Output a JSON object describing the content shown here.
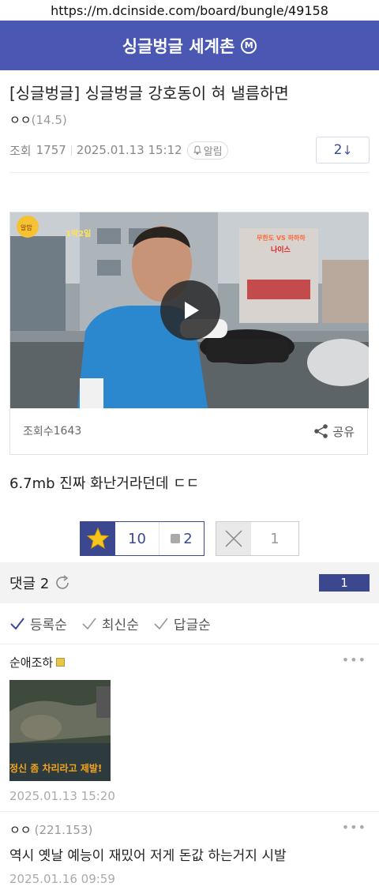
{
  "browser": {
    "url": "https://m.dcinside.com/board/bungle/49158"
  },
  "gallery": {
    "title": "싱글벙글 세계촌",
    "badge": "M"
  },
  "post": {
    "title": "[싱글벙글] 싱글벙글 강호동이 혀 낼름하면",
    "writer": "ㅇㅇ",
    "writer_ip": "(14.5)",
    "views_label": "조회",
    "views": "1757",
    "date": "2025.01.13 15:12",
    "alarm_label": "알림",
    "comment_count": "2",
    "body_text": "6.7mb 진짜 화난거라던데 ㄷㄷ"
  },
  "video": {
    "views_label": "조회수",
    "views": "1643",
    "share_label": "공유",
    "overlay_logo": "알밥",
    "overlay_title": "1박2일",
    "overlay_right_1": "무한도 VS 하하하",
    "overlay_right_2": "나이스"
  },
  "votes": {
    "recommend": "10",
    "fix": "2",
    "nonrecommend": "1"
  },
  "comments_header": {
    "label": "댓글",
    "count": "2",
    "page": "1"
  },
  "sort": {
    "items": [
      "등록순",
      "최신순",
      "답글순"
    ]
  },
  "comments": [
    {
      "name": "순애조하",
      "ip": "",
      "dccon_caption": "정신 좀 차리라고 제발!",
      "text": "",
      "date": "2025.01.13 15:20"
    },
    {
      "name": "ㅇㅇ",
      "ip": "(221.153)",
      "text": "역시 옛날 예능이 재밌어 저게 돈값 하는거지 시발",
      "date": "2025.01.16 09:59"
    }
  ],
  "colors": {
    "brand": "#4a58b4",
    "accent": "#3b4890"
  },
  "icons": [
    "play-icon",
    "share-icon",
    "star-icon",
    "x-icon",
    "refresh-icon",
    "check-icon",
    "bell-icon",
    "more-icon"
  ]
}
